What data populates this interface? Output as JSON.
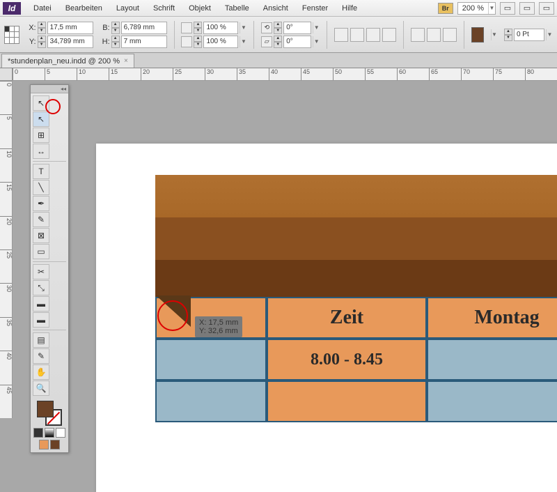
{
  "menu": {
    "items": [
      "Datei",
      "Bearbeiten",
      "Layout",
      "Schrift",
      "Objekt",
      "Tabelle",
      "Ansicht",
      "Fenster",
      "Hilfe"
    ],
    "br": "Br",
    "zoom": "200 %"
  },
  "ctrl": {
    "x": "17,5 mm",
    "y": "34,789 mm",
    "w": "6,789 mm",
    "h": "7 mm",
    "sx": "100 %",
    "sy": "100 %",
    "rot": "0°",
    "shear": "0°",
    "stroke": "0 Pt"
  },
  "tab": {
    "name": "*stundenplan_neu.indd @ 200 %"
  },
  "ruler_h": [
    "0",
    "5",
    "10",
    "15",
    "20",
    "25",
    "30",
    "35",
    "40",
    "45",
    "50",
    "55",
    "60",
    "65",
    "70",
    "75",
    "80"
  ],
  "ruler_v": [
    "0",
    "5",
    "10",
    "15",
    "20",
    "25",
    "30",
    "35",
    "40",
    "45"
  ],
  "cells": {
    "zeit": "Zeit",
    "montag": "Montag",
    "slot1": "8.00 - 8.45"
  },
  "tooltip": {
    "x": "X: 17,5 mm",
    "y": "Y: 32,6 mm"
  },
  "labels": {
    "X": "X:",
    "Y": "Y:",
    "B": "B:",
    "H": "H:"
  }
}
